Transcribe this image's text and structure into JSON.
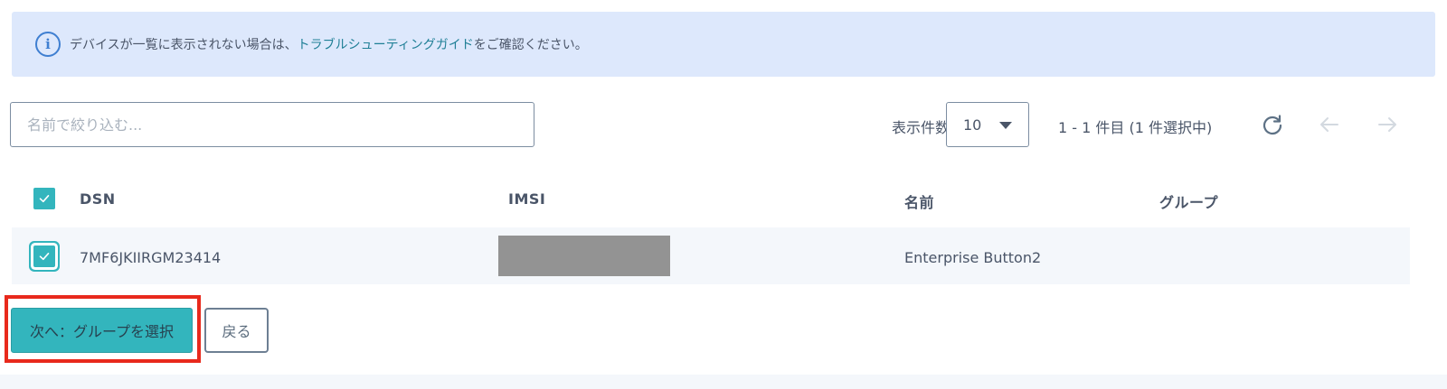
{
  "info_banner": {
    "text_before": "デバイスが一覧に表示されない場合は、",
    "link_text": "トラブルシューティングガイド",
    "text_after": "をご確認ください。",
    "icon": "info-icon"
  },
  "filter": {
    "placeholder": "名前で絞り込む...",
    "value": ""
  },
  "pagination": {
    "per_page_label": "表示件数",
    "per_page_value": "10",
    "range_text": "1 - 1 件目 (1 件選択中)",
    "icons": [
      "refresh-icon",
      "arrow-left-icon",
      "arrow-right-icon"
    ]
  },
  "table": {
    "columns": [
      "DSN",
      "IMSI",
      "名前",
      "グループ"
    ],
    "all_selected": true,
    "rows": [
      {
        "dsn": "7MF6JKIIRGM23414",
        "imsi": "",
        "name": "Enterprise Button2",
        "group": "",
        "selected": true
      }
    ]
  },
  "actions": {
    "next_label": "次へ：グループを選択",
    "back_label": "戻る"
  },
  "colors": {
    "accent": "#33b5bd",
    "banner_bg": "#dde8fc",
    "link": "#1f7f96",
    "highlight": "#e8291c"
  }
}
